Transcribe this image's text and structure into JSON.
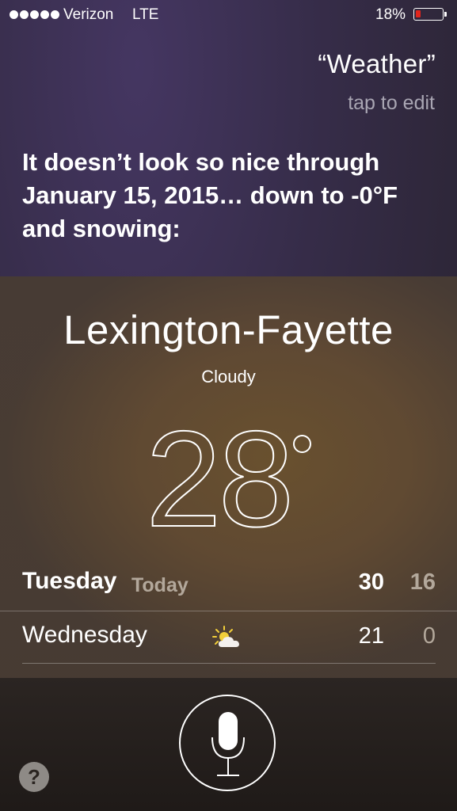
{
  "status_bar": {
    "carrier": "Verizon",
    "network": "LTE",
    "battery_percent": "18%",
    "battery_level": 0.18,
    "battery_color": "#e0251c"
  },
  "siri": {
    "query": "“Weather”",
    "tap_to_edit": "tap to edit",
    "response": "It doesn’t look so nice through January 15, 2015… down to -0°F and snowing:"
  },
  "weather": {
    "city": "Lexington-Fayette",
    "condition": "Cloudy",
    "temperature": "28",
    "days": [
      {
        "name": "Tuesday",
        "label": "Today",
        "high": "30",
        "low": "16",
        "icon": ""
      },
      {
        "name": "Wednesday",
        "label": "",
        "high": "21",
        "low": "0",
        "icon": "partly-cloudy-icon"
      }
    ]
  },
  "bottom": {
    "help_label": "?",
    "mic_icon": "microphone-icon"
  }
}
